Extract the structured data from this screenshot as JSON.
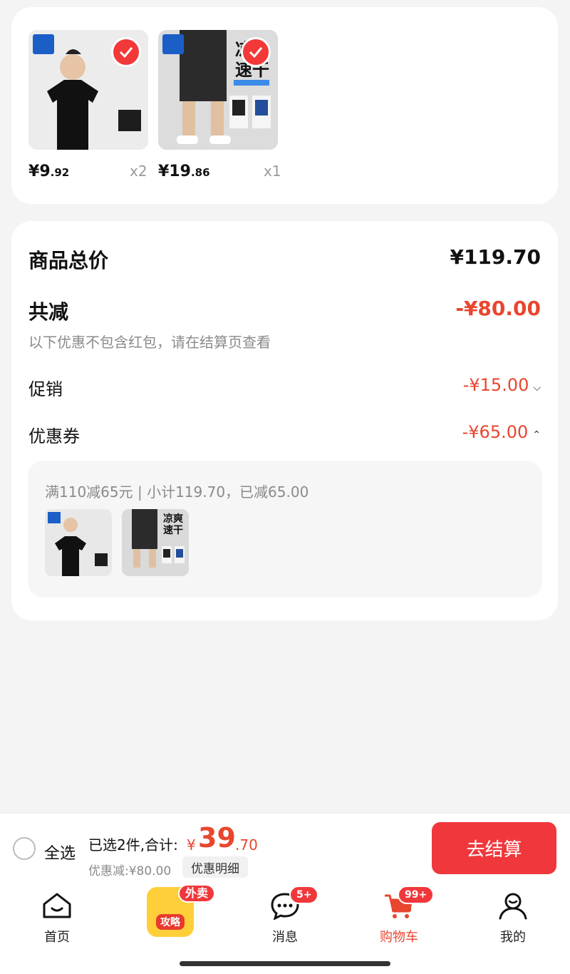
{
  "products": [
    {
      "price_symbol": "¥",
      "price_int": "9",
      "price_dec": ".92",
      "qty": "x2"
    },
    {
      "price_symbol": "¥",
      "price_int": "19",
      "price_dec": ".86",
      "qty": "x1",
      "tag_line1": "凉",
      "tag_line2": "速干"
    }
  ],
  "summary": {
    "total_label": "商品总价",
    "total_value": "¥119.70",
    "discount_label": "共减",
    "discount_value": "-¥80.00",
    "discount_note": "以下优惠不包含红包，请在结算页查看",
    "promo_label": "促销",
    "promo_value": "-¥15.00",
    "coupon_label": "优惠券",
    "coupon_value": "-¥65.00",
    "coupon_detail": "满110减65元 | 小计119.70，已减65.00",
    "mini_tag_line1": "凉爽",
    "mini_tag_line2": "速干"
  },
  "checkout": {
    "select_all": "全选",
    "selected_info": "已选2件,合计:",
    "total_currency": "¥",
    "total_int": "39",
    "total_dec": ".70",
    "discount_info": "优惠减:¥80.00",
    "detail_button": "优惠明细",
    "checkout_button": "去结算"
  },
  "tabs": [
    {
      "label": "首页",
      "icon": "home-icon"
    },
    {
      "label": "外卖",
      "icon": "promo-tile",
      "promo_text": "攻略"
    },
    {
      "label": "消息",
      "icon": "message-icon",
      "badge": "5+"
    },
    {
      "label": "购物车",
      "icon": "cart-icon",
      "badge": "99+",
      "active": true
    },
    {
      "label": "我的",
      "icon": "profile-icon"
    }
  ],
  "colors": {
    "accent": "#f0383c",
    "price_red": "#e8462f",
    "brand_blue": "#1b5fc6"
  }
}
